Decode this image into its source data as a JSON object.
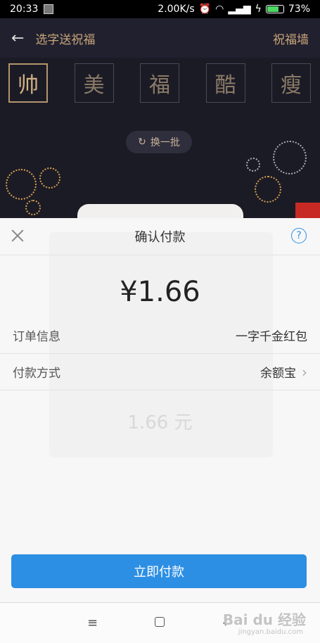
{
  "status_bar": {
    "time": "20:33",
    "speed": "2.00K/s",
    "battery": "73%",
    "battery_level": 0.73
  },
  "header": {
    "title": "选字送祝福",
    "right_link": "祝福墙"
  },
  "characters": [
    "帅",
    "美",
    "福",
    "酷",
    "瘦"
  ],
  "refresh_label": "换一批",
  "sheet": {
    "title": "确认付款",
    "amount": "¥1.66",
    "order_label": "订单信息",
    "order_value": "一字千金红包",
    "method_label": "付款方式",
    "method_value": "余额宝"
  },
  "pay_button_label": "立即付款",
  "ghost_amount": "1.66 元",
  "watermark": {
    "brand": "Bai du 经验",
    "url": "jingyan.baidu.com"
  }
}
